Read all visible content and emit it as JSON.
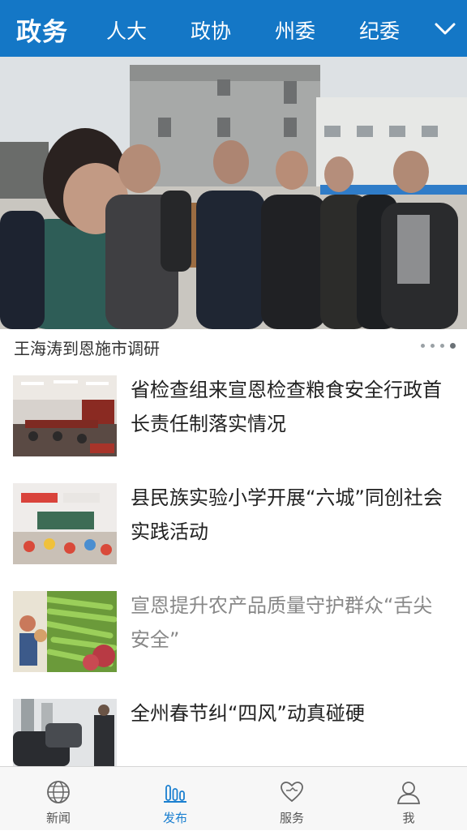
{
  "header": {
    "title": "政务",
    "tabs": [
      "人大",
      "政协",
      "州委",
      "纪委"
    ]
  },
  "hero": {
    "caption": "王海涛到恩施市调研",
    "dots": 4,
    "active_dot": 3
  },
  "news": [
    {
      "title": "省检查组来宣恩检查粮食安全行政首长责任制落实情况",
      "read": false
    },
    {
      "title": "县民族实验小学开展“六城”同创社会实践活动",
      "read": false
    },
    {
      "title": "宣恩提升农产品质量守护群众“舌尖安全”",
      "read": true
    },
    {
      "title": "全州春节纠“四风”动真碰硬",
      "read": false
    }
  ],
  "tabbar": [
    {
      "label": "新闻",
      "icon": "globe-icon",
      "active": false
    },
    {
      "label": "发布",
      "icon": "bar-chart-icon",
      "active": true
    },
    {
      "label": "服务",
      "icon": "heart-handshake-icon",
      "active": false
    },
    {
      "label": "我",
      "icon": "person-icon",
      "active": false
    }
  ],
  "colors": {
    "primary": "#1477c6",
    "active_tab": "#1a7fd0",
    "read_title": "#888888"
  }
}
